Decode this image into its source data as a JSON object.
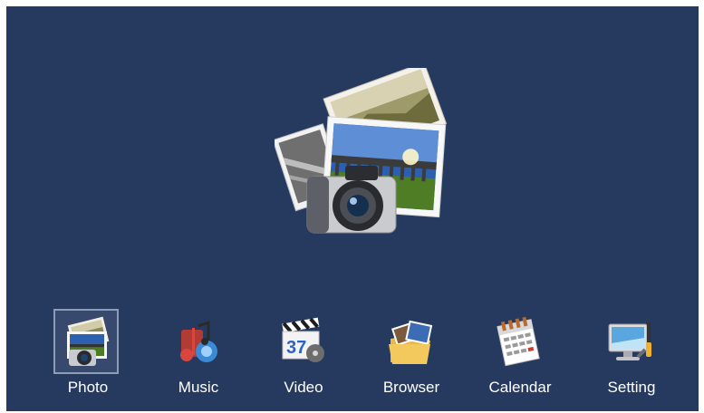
{
  "hero": {
    "icon": "photo-camera-icon"
  },
  "menu": {
    "selected_index": 0,
    "items": [
      {
        "label": "Photo",
        "icon": "photo-icon"
      },
      {
        "label": "Music",
        "icon": "music-icon"
      },
      {
        "label": "Video",
        "icon": "video-icon"
      },
      {
        "label": "Browser",
        "icon": "browser-icon"
      },
      {
        "label": "Calendar",
        "icon": "calendar-icon"
      },
      {
        "label": "Setting",
        "icon": "setting-icon"
      }
    ],
    "video_icon_number": "37"
  },
  "colors": {
    "background": "#263a60",
    "frame": "#ffffff",
    "label": "#ffffff",
    "selection_border": "#8d9cb9"
  }
}
